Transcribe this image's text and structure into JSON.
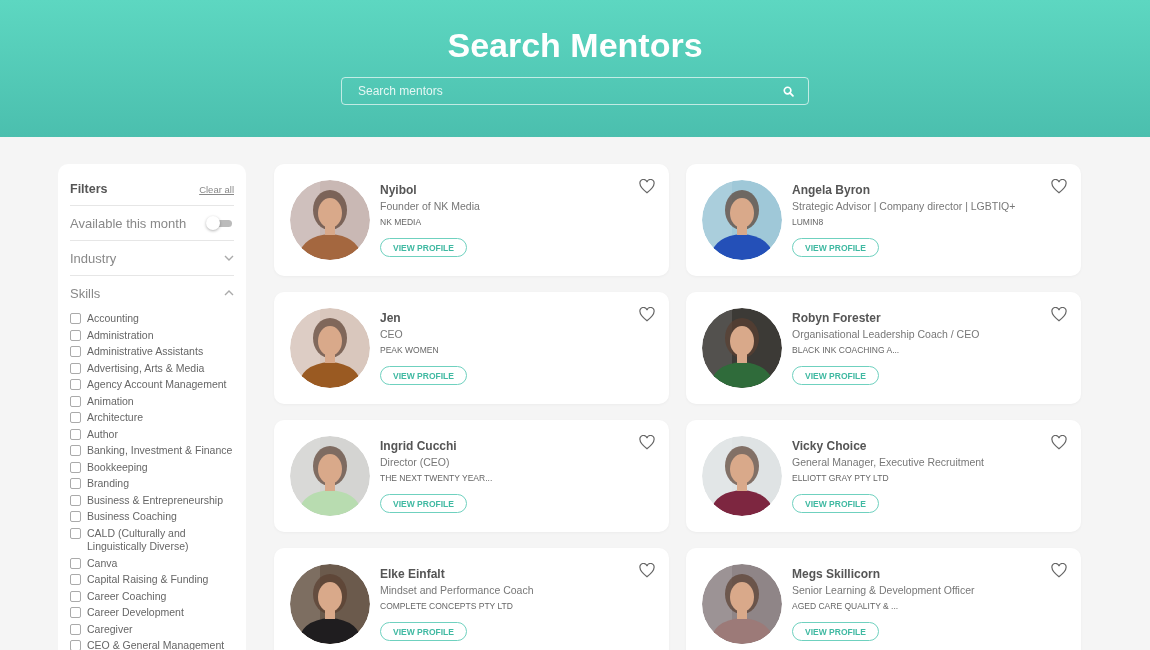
{
  "header": {
    "title": "Search Mentors",
    "search": {
      "placeholder": "Search mentors"
    }
  },
  "filters": {
    "title": "Filters",
    "clear": "Clear all",
    "toggle": {
      "label": "Available this month",
      "on": false
    },
    "sections": [
      {
        "label": "Industry",
        "expanded": false
      },
      {
        "label": "Skills",
        "expanded": true
      }
    ],
    "skills": [
      {
        "label": "Accounting",
        "checked": false
      },
      {
        "label": "Administration",
        "checked": false
      },
      {
        "label": "Administrative Assistants",
        "checked": false
      },
      {
        "label": "Advertising, Arts & Media",
        "checked": false
      },
      {
        "label": "Agency Account Management",
        "checked": false
      },
      {
        "label": "Animation",
        "checked": false
      },
      {
        "label": "Architecture",
        "checked": false
      },
      {
        "label": "Author",
        "checked": false
      },
      {
        "label": "Banking, Investment & Finance",
        "checked": false
      },
      {
        "label": "Bookkeeping",
        "checked": false
      },
      {
        "label": "Branding",
        "checked": false
      },
      {
        "label": "Business & Entrepreneurship",
        "checked": false
      },
      {
        "label": "Business Coaching",
        "checked": false
      },
      {
        "label": "CALD (Culturally and Linguistically Diverse)",
        "checked": false
      },
      {
        "label": "Canva",
        "checked": false
      },
      {
        "label": "Capital Raising & Funding",
        "checked": false
      },
      {
        "label": "Career Coaching",
        "checked": false
      },
      {
        "label": "Career Development",
        "checked": false
      },
      {
        "label": "Caregiver",
        "checked": false
      },
      {
        "label": "CEO & General Management",
        "checked": false
      }
    ]
  },
  "mentors": [
    {
      "name": "Nyibol",
      "role": "Founder of NK Media",
      "company": "NK MEDIA",
      "button": "VIEW PROFILE",
      "favorite": false
    },
    {
      "name": "Angela Byron",
      "role": "Strategic Advisor | Company director | LGBTIQ+",
      "company": "LUMIN8",
      "button": "VIEW PROFILE",
      "favorite": false
    },
    {
      "name": "Jen",
      "role": "CEO",
      "company": "PEAK WOMEN",
      "button": "VIEW PROFILE",
      "favorite": false
    },
    {
      "name": "Robyn Forester",
      "role": "Organisational Leadership Coach / CEO",
      "company": "BLACK INK COACHING A...",
      "button": "VIEW PROFILE",
      "favorite": false
    },
    {
      "name": "Ingrid Cucchi",
      "role": "Director (CEO)",
      "company": "THE NEXT TWENTY YEAR...",
      "button": "VIEW PROFILE",
      "favorite": false
    },
    {
      "name": "Vicky Choice",
      "role": "General Manager, Executive Recruitment",
      "company": "ELLIOTT GRAY PTY LTD",
      "button": "VIEW PROFILE",
      "favorite": false
    },
    {
      "name": "Elke Einfalt",
      "role": "Mindset and Performance Coach",
      "company": "COMPLETE CONCEPTS PTY LTD",
      "button": "VIEW PROFILE",
      "favorite": false
    },
    {
      "name": "Megs Skillicorn",
      "role": "Senior Learning & Development Officer",
      "company": "AGED CARE QUALITY & ...",
      "button": "VIEW PROFILE",
      "favorite": false
    }
  ]
}
